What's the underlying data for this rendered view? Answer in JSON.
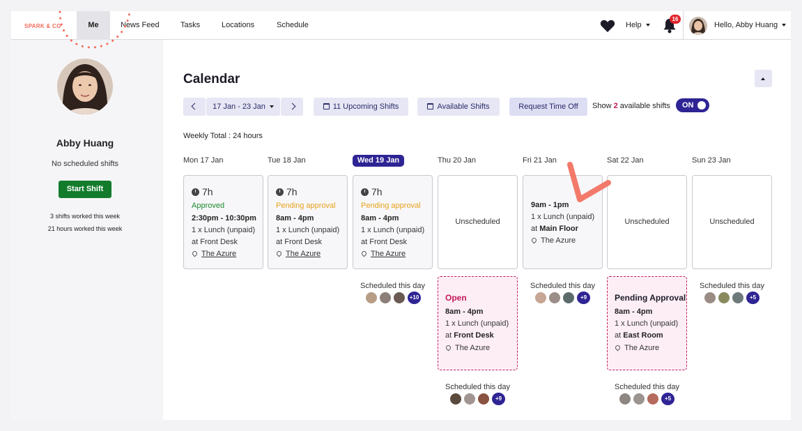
{
  "nav": {
    "logo": "SPARK & CO",
    "items": [
      "Me",
      "News Feed",
      "Tasks",
      "Locations",
      "Schedule"
    ],
    "help": "Help",
    "notification_count": "16",
    "greeting": "Hello, Abby Huang"
  },
  "sidebar": {
    "name": "Abby Huang",
    "no_shifts": "No scheduled shifts",
    "start_shift": "Start Shift",
    "shifts_worked": "3 shifts worked this week",
    "hours_worked": "21 hours worked this week"
  },
  "calendar": {
    "title": "Calendar",
    "date_range": "17 Jan - 23 Jan",
    "upcoming": "11 Upcoming Shifts",
    "available": "Available Shifts",
    "request_off": "Request Time Off",
    "show_prefix": "Show",
    "show_count": "2",
    "show_suffix": "available shifts",
    "toggle": "ON",
    "weekly_total": "Weekly Total : 24 hours",
    "days": [
      "Mon 17 Jan",
      "Tue 18 Jan",
      "Wed 19 Jan",
      "Thu 20 Jan",
      "Fri 21 Jan",
      "Sat 22 Jan",
      "Sun 23 Jan"
    ],
    "shifts": [
      {
        "hours": "7h",
        "status": "Approved",
        "time": "2:30pm - 10:30pm",
        "break": "1 x Lunch (unpaid)",
        "at": "at Front Desk",
        "location": "The Azure"
      },
      {
        "hours": "7h",
        "status": "Pending approval",
        "time": "8am - 4pm",
        "break": "1 x Lunch (unpaid)",
        "at": "at Front Desk",
        "location": "The Azure"
      },
      {
        "hours": "7h",
        "status": "Pending approval",
        "time": "8am - 4pm",
        "break": "1 x Lunch (unpaid)",
        "at": "at Front Desk",
        "location": "The Azure"
      }
    ],
    "unscheduled": "Unscheduled",
    "fri_shift": {
      "time": "9am - 1pm",
      "break": "1 x Lunch (unpaid)",
      "at_prefix": "at",
      "at_place": "Main Floor",
      "location": "The Azure"
    },
    "scheduled_this_day": "Scheduled this day",
    "more_counts": {
      "wed": "+10",
      "fri": "+9",
      "sun": "+5",
      "thu": "+9",
      "sat": "+5"
    },
    "open_shift": {
      "title": "Open",
      "time": "8am - 4pm",
      "break": "1 x Lunch (unpaid)",
      "at_prefix": "at",
      "at_place": "Front Desk",
      "location": "The Azure"
    },
    "pending_shift": {
      "title": "Pending Approval",
      "time": "8am - 4pm",
      "break": "1 x Lunch (unpaid)",
      "at_prefix": "at",
      "at_place": "East Room",
      "location": "The Azure"
    }
  },
  "colors": {
    "accent": "#2e2494",
    "approved": "#1d8a2e",
    "pending": "#e8a21a",
    "open": "#c4185a",
    "start_button": "#137c2c",
    "logo": "#f26b5b"
  }
}
